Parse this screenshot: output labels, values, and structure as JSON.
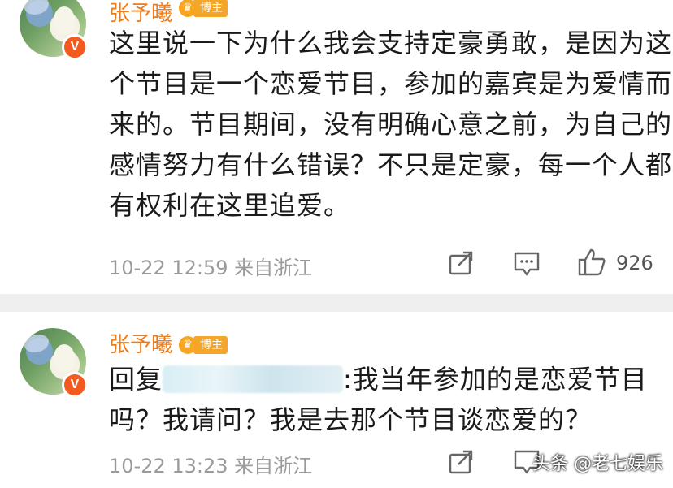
{
  "post1": {
    "username": "张予曦",
    "tag_label": "博主",
    "verified_glyph": "V",
    "lines": [
      "这里说一下为什么我会支持定豪勇敢，是因为这",
      "个节目是一个恋爱节目，参加的嘉宾是为爱情而",
      "来的。节目期间，没有明确心意之前，为自己的",
      "感情努力有什么错误？不只是定豪，每一个人都",
      "有权利在这里追爱。"
    ],
    "timestamp": "10-22 12:59",
    "location": "来自浙江",
    "like_count": "926"
  },
  "post2": {
    "username": "张予曦",
    "tag_label": "博主",
    "verified_glyph": "V",
    "reply_prefix": "回复",
    "reply_rest": ":我当年参加的是恋爱节目",
    "line2": "吗？我请问？我是去那个节目谈恋爱的？",
    "timestamp": "10-22 13:23",
    "location": "来自浙江"
  },
  "watermark": "头条 @老七娱乐",
  "colors": {
    "name": "#ee7b1a",
    "tag": "#f4a62a",
    "verified": "#f25a1f",
    "separator": "#efefef"
  },
  "icons": [
    "share-icon",
    "comment-icon",
    "like-icon"
  ]
}
